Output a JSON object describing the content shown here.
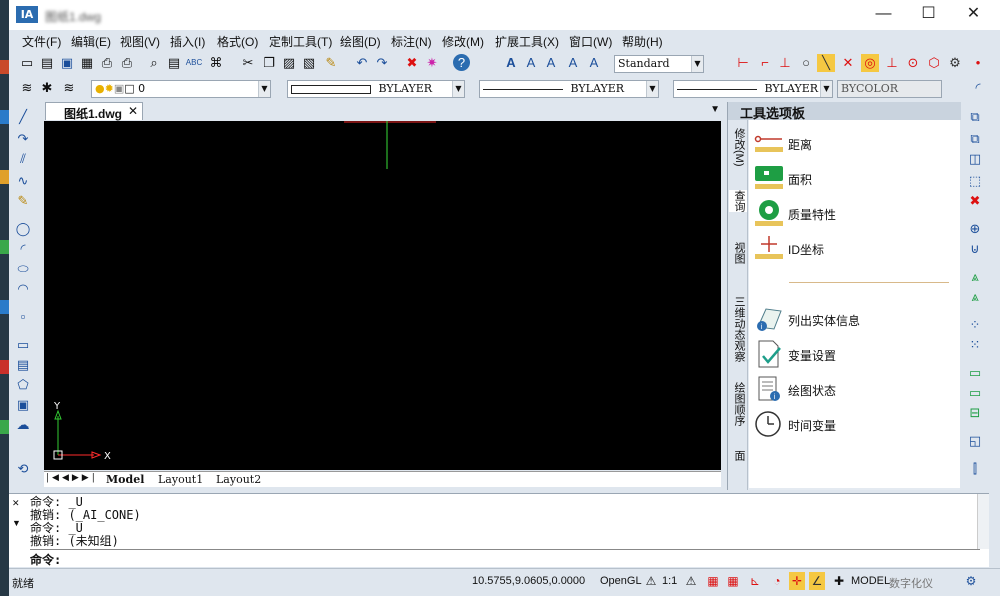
{
  "window": {
    "logo": "IA",
    "title": "图纸1.dwg",
    "controls": {
      "min": "—",
      "max": "☐",
      "close": "✕"
    }
  },
  "menu": [
    "文件(F)",
    "编辑(E)",
    "视图(V)",
    "插入(I)",
    "格式(O)",
    "定制工具(T)",
    "绘图(D)",
    "标注(N)",
    "修改(M)",
    "扩展工具(X)",
    "窗口(W)",
    "帮助(H)"
  ],
  "toolbar": {
    "text_style": "Standard",
    "layer": "0",
    "color": "BYLAYER",
    "linetype": "BYLAYER",
    "lineweight": "BYLAYER",
    "plot_style": "BYCOLOR"
  },
  "document": {
    "tab": "图纸1.dwg",
    "close": "✕"
  },
  "ucs": {
    "y": "Y",
    "x": "X"
  },
  "layout_tabs": [
    "Model",
    "Layout1",
    "Layout2"
  ],
  "palette": {
    "title": "工具选项板",
    "side_tabs": [
      "修改(M)",
      "查询",
      "视图",
      "三维动态观察",
      "绘图顺序",
      "面"
    ],
    "items": [
      {
        "label": "距离",
        "icon": "distance-icon"
      },
      {
        "label": "面积",
        "icon": "area-icon"
      },
      {
        "label": "质量特性",
        "icon": "mass-properties-icon"
      },
      {
        "label": "ID坐标",
        "icon": "id-point-icon"
      },
      {
        "label": "列出实体信息",
        "icon": "list-info-icon"
      },
      {
        "label": "变量设置",
        "icon": "setvar-icon"
      },
      {
        "label": "绘图状态",
        "icon": "drawing-status-icon"
      },
      {
        "label": "时间变量",
        "icon": "time-icon"
      }
    ]
  },
  "command": {
    "history": [
      "命令:  _U",
      "撤销: (_AI_CONE)",
      "命令:  _U",
      "撤销: (未知组)"
    ],
    "prompt": "命令:"
  },
  "status": {
    "ready": "就绪",
    "coords": "10.5755,9.0605,0.0000",
    "renderer": "OpenGL",
    "scale": "1:1",
    "space": "MODEL",
    "digital": "数字化仪"
  },
  "colors": {
    "canvas": "#000000",
    "accent": "#1b4e9a",
    "x_axis": "#ff2d2d",
    "y_axis": "#33cc33"
  }
}
